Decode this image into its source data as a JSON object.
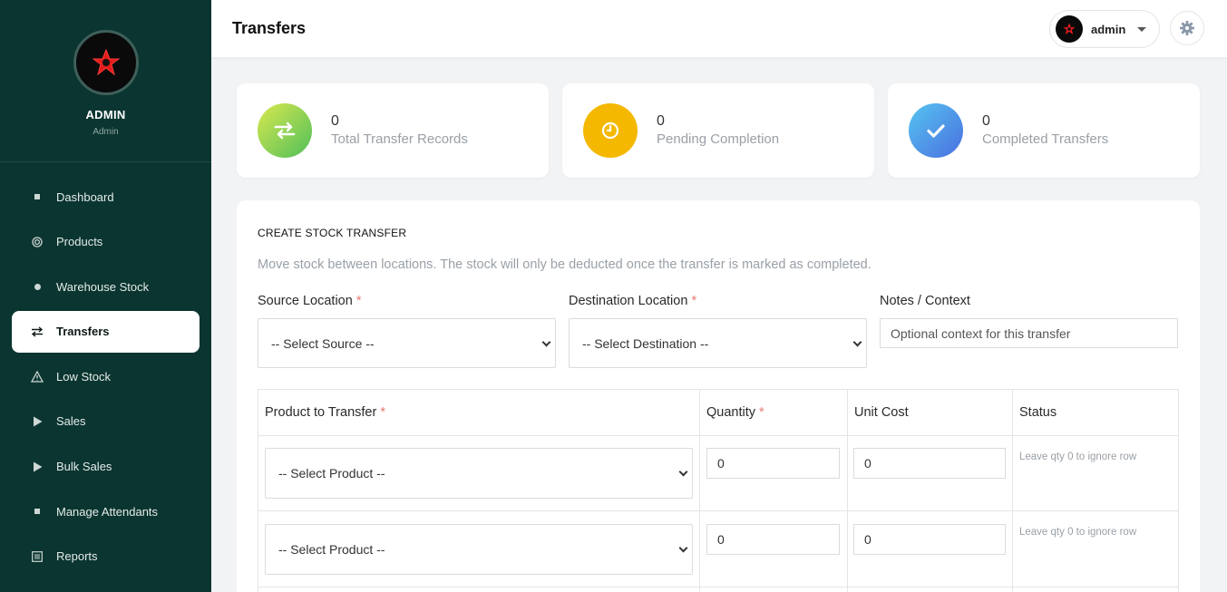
{
  "sidebar": {
    "profile_name": "ADMIN",
    "profile_role": "Admin",
    "items": [
      {
        "label": "Dashboard",
        "icon": "square-dot-icon"
      },
      {
        "label": "Products",
        "icon": "target-icon"
      },
      {
        "label": "Warehouse Stock",
        "icon": "circle-dot-icon"
      },
      {
        "label": "Transfers",
        "icon": "swap-arrows-icon",
        "active": true
      },
      {
        "label": "Low Stock",
        "icon": "warning-triangle-icon"
      },
      {
        "label": "Sales",
        "icon": "play-icon"
      },
      {
        "label": "Bulk Sales",
        "icon": "play-icon"
      },
      {
        "label": "Manage Attendants",
        "icon": "square-dot-icon"
      },
      {
        "label": "Reports",
        "icon": "list-icon"
      }
    ]
  },
  "header": {
    "title": "Transfers",
    "username": "admin"
  },
  "stats": [
    {
      "value": "0",
      "label": "Total Transfer Records",
      "icon": "swap-arrows-icon"
    },
    {
      "value": "0",
      "label": "Pending Completion",
      "icon": "clock-icon"
    },
    {
      "value": "0",
      "label": "Completed Transfers",
      "icon": "check-icon"
    }
  ],
  "form": {
    "title": "CREATE STOCK TRANSFER",
    "description": "Move stock between locations. The stock will only be deducted once the transfer is marked as completed.",
    "source_label": "Source Location",
    "source_value": "-- Select Source --",
    "destination_label": "Destination Location",
    "destination_value": "-- Select Destination --",
    "notes_label": "Notes / Context",
    "notes_placeholder": "Optional context for this transfer",
    "required_mark": "*"
  },
  "table": {
    "headers": [
      "Product to Transfer",
      "Quantity",
      "Unit Cost",
      "Status"
    ],
    "rows": [
      {
        "product": "-- Select Product --",
        "quantity": "0",
        "unit_cost": "0",
        "status": "Leave qty 0 to ignore row"
      },
      {
        "product": "-- Select Product --",
        "quantity": "0",
        "unit_cost": "0",
        "status": "Leave qty 0 to ignore row"
      }
    ]
  },
  "colors": {
    "sidebar_bg": "#0b3530",
    "stat_green": "#8cc94a",
    "stat_yellow": "#f5b800",
    "stat_blue": "#4f8fe8",
    "required": "#e77a6e"
  }
}
